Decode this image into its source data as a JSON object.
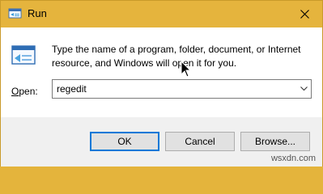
{
  "window": {
    "title": "Run",
    "close_icon": "close-icon"
  },
  "content": {
    "description": "Type the name of a program, folder, document, or Internet resource, and Windows will open it for you.",
    "open_label_prefix": "O",
    "open_label_rest": "pen:",
    "open_value": "regedit"
  },
  "buttons": {
    "ok": "OK",
    "cancel": "Cancel",
    "browse": "Browse..."
  },
  "watermark": "wsxdn.com",
  "colors": {
    "titlebar": "#e5b43d",
    "accent": "#0078d7",
    "footer": "#f0f0f0"
  }
}
